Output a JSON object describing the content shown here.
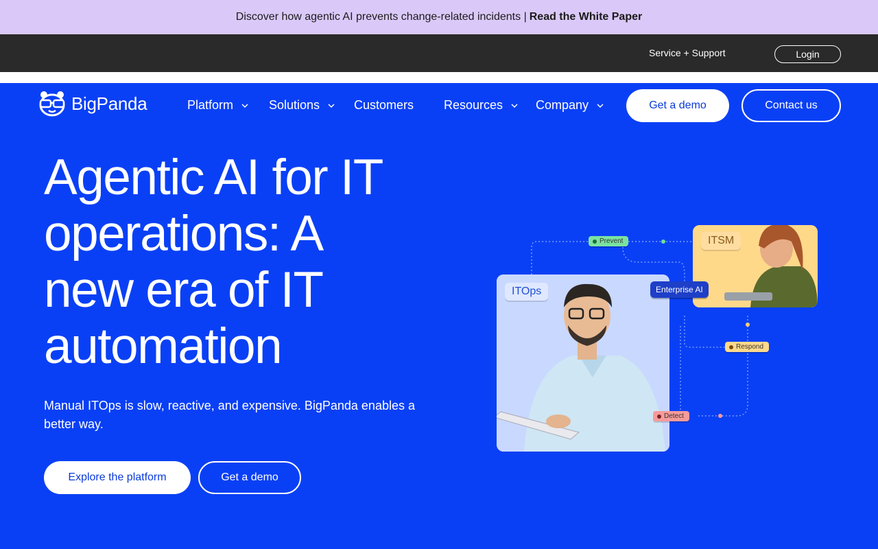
{
  "announcement": {
    "text": "Discover how agentic AI prevents change-related incidents |",
    "link": "Read the White Paper"
  },
  "utility": {
    "support": "Service + Support",
    "login": "Login"
  },
  "nav": {
    "logo": "BigPanda",
    "items": [
      {
        "label": "Platform",
        "dropdown": true
      },
      {
        "label": "Solutions",
        "dropdown": true
      },
      {
        "label": "Customers",
        "dropdown": false
      },
      {
        "label": "Resources",
        "dropdown": true
      },
      {
        "label": "Company",
        "dropdown": true
      }
    ],
    "demo": "Get a demo",
    "contact": "Contact us"
  },
  "hero": {
    "title_lines": [
      "Agentic AI for IT",
      "operations: A",
      "new era of IT",
      "automation"
    ],
    "subtitle": "Manual ITOps is slow, reactive, and expensive. BigPanda enables a better way.",
    "primary_cta": "Explore the platform",
    "secondary_cta": "Get a demo"
  },
  "illustration": {
    "itops": "ITOps",
    "itsm": "ITSM",
    "enterprise": "Enterprise AI",
    "prevent": "Prevent",
    "respond": "Respond",
    "detect": "Detect"
  },
  "colors": {
    "brand_blue": "#0a40f5",
    "announce_bg": "#dac9f8",
    "utility_bg": "#2a2a2a",
    "prevent_green": "#7be3a0",
    "respond_yellow": "#ffd98a",
    "detect_red": "#f79a9a"
  }
}
